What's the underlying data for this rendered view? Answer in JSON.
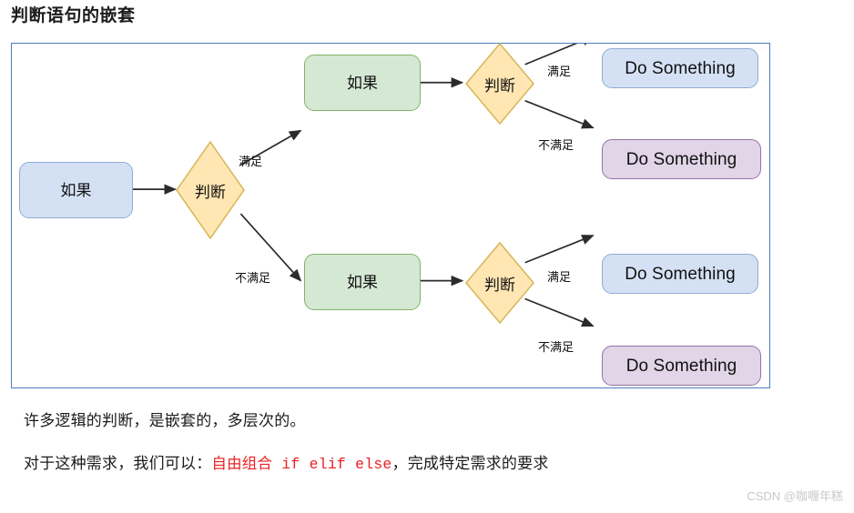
{
  "page": {
    "title": "判断语句的嵌套",
    "watermark": "CSDN @咖喱年糕"
  },
  "colors": {
    "frame_border": "#4a7ebb",
    "blue_fill": "#d4e1f5",
    "blue_border": "#8faad4",
    "green_fill": "#d5e8d4",
    "green_border": "#82b366",
    "purple_fill": "#e1d5e7",
    "purple_border": "#9673a6",
    "diamond_fill": "#ffe6b3",
    "diamond_border": "#d6b656",
    "edge_stroke": "#2b2b2b",
    "code_red": "#ec2024",
    "watermark": "#c9c9c9"
  },
  "diagram": {
    "nodes": {
      "start_if": "如果",
      "decision_1": "判断",
      "branch_true_if": "如果",
      "branch_false_if": "如果",
      "decision_2": "判断",
      "decision_3": "判断",
      "do_1": "Do Something",
      "do_2": "Do Something",
      "do_3": "Do Something",
      "do_4": "Do Something"
    },
    "edge_labels": {
      "e1_satisfied": "满足",
      "e2_not_satisfied": "不满足",
      "e3_satisfied": "满足",
      "e4_not_satisfied": "不满足",
      "e5_satisfied": "满足",
      "e6_not_satisfied": "不满足"
    }
  },
  "body": {
    "para_1": "许多逻辑的判断，是嵌套的，多层次的。",
    "para_2_prefix": "对于这种需求，我们可以：",
    "para_2_code": "自由组合 if elif else",
    "para_2_suffix": "，完成特定需求的要求"
  }
}
